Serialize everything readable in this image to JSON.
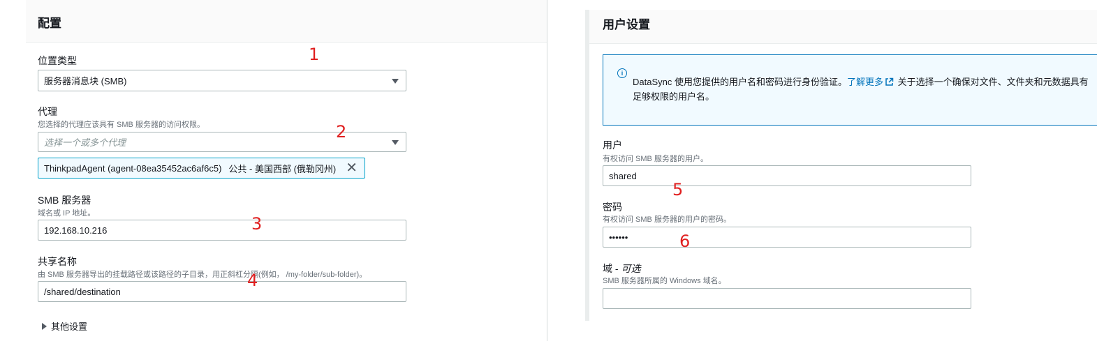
{
  "left": {
    "title": "配置",
    "location_type": {
      "label": "位置类型",
      "value": "服务器消息块 (SMB)"
    },
    "agent": {
      "label": "代理",
      "desc": "您选择的代理应该具有 SMB 服务器的访问权限。",
      "placeholder": "选择一个或多个代理",
      "token_name": "ThinkpadAgent (agent-08ea35452ac6af6c5)",
      "token_region": "公共 - 美国西部 (俄勒冈州)",
      "token_remove": "✕"
    },
    "smb_server": {
      "label": "SMB 服务器",
      "desc": "域名或 IP 地址。",
      "value": "192.168.10.216"
    },
    "share_name": {
      "label": "共享名称",
      "desc": "由 SMB 服务器导出的挂载路径或该路径的子目录，用正斜杠分隔(例如， /my-folder/sub-folder)。",
      "value": "/shared/destination"
    },
    "other_settings": "其他设置"
  },
  "right": {
    "title": "用户设置",
    "info": {
      "icon": "i",
      "text_before": "DataSync 使用您提供的用户名和密码进行身份验证。",
      "link": "了解更多",
      "text_after": " 关于选择一个确保对文件、文件夹和元数据具有足够权限的用户名。"
    },
    "user": {
      "label": "用户",
      "desc": "有权访问 SMB 服务器的用户。",
      "value": "shared"
    },
    "password": {
      "label": "密码",
      "desc": "有权访问 SMB 服务器的用户的密码。",
      "value": "••••••"
    },
    "domain": {
      "label": "域 - ",
      "label_optional": "可选",
      "desc": "SMB 服务器所属的 Windows 域名。",
      "value": ""
    }
  },
  "annotations": [
    "1",
    "2",
    "3",
    "4",
    "5",
    "6"
  ],
  "colors": {
    "annotation": "#e02020",
    "link": "#0073bb",
    "token_border": "#00a1c9",
    "info_bg": "#f1faff"
  }
}
